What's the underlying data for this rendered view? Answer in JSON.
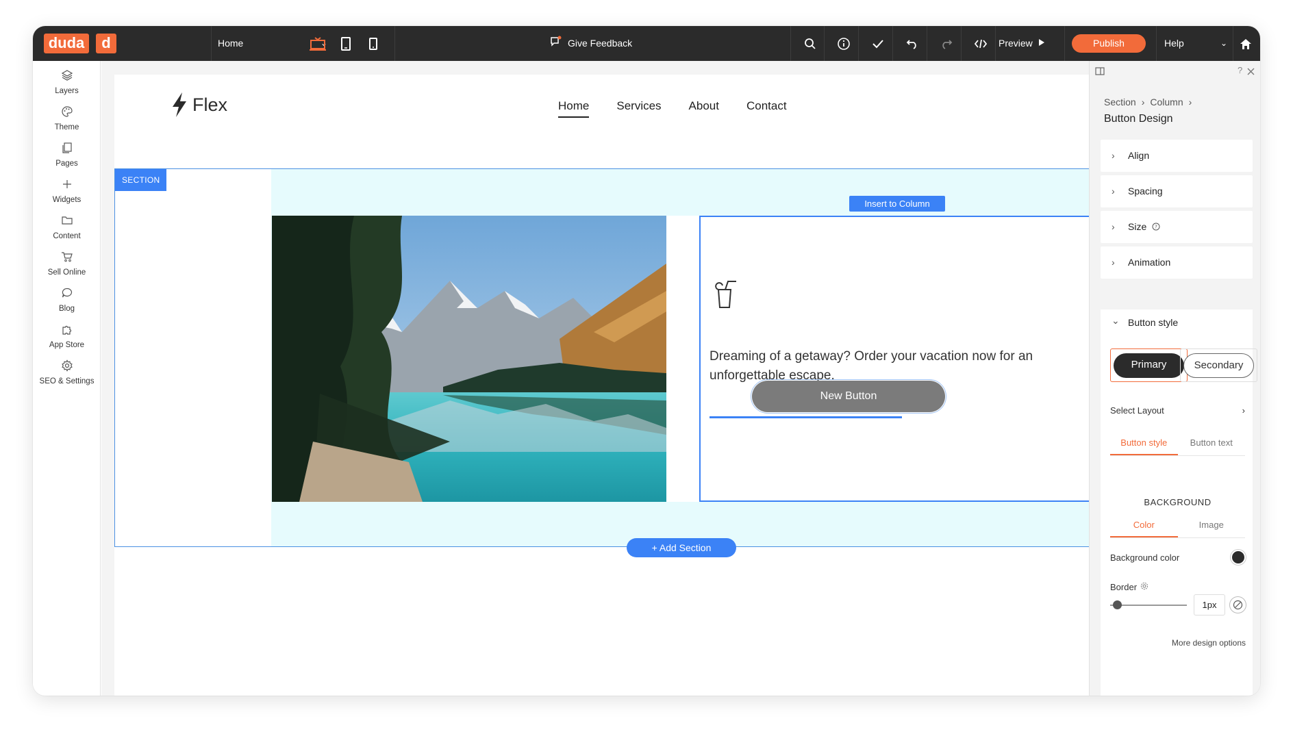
{
  "topbar": {
    "logo": "duda",
    "logo_short": "d",
    "page_selector": "Home",
    "feedback": "Give Feedback",
    "preview": "Preview",
    "publish": "Publish",
    "help": "Help"
  },
  "sidebar": {
    "items": [
      {
        "label": "Layers",
        "icon": "layers-icon"
      },
      {
        "label": "Theme",
        "icon": "palette-icon"
      },
      {
        "label": "Pages",
        "icon": "pages-icon"
      },
      {
        "label": "Widgets",
        "icon": "plus-icon"
      },
      {
        "label": "Content",
        "icon": "folder-icon"
      },
      {
        "label": "Sell Online",
        "icon": "cart-icon"
      },
      {
        "label": "Blog",
        "icon": "chat-icon"
      },
      {
        "label": "App Store",
        "icon": "puzzle-icon"
      },
      {
        "label": "SEO & Settings",
        "icon": "gear-icon"
      }
    ]
  },
  "site": {
    "logo_text": "Flex",
    "nav": [
      "Home",
      "Services",
      "About",
      "Contact"
    ],
    "section_tag": "SECTION",
    "insert_column": "Insert to Column",
    "body_text": "Dreaming of a getaway? Order your vacation now for an unforgettable escape.",
    "button_label": "New Button",
    "add_section": "+ Add Section"
  },
  "panel": {
    "breadcrumb": [
      "Section",
      "Column"
    ],
    "title": "Button Design",
    "accordions": [
      "Align",
      "Spacing",
      "Size",
      "Animation"
    ],
    "button_style": {
      "label": "Button style",
      "primary": "Primary",
      "secondary": "Secondary",
      "select_layout": "Select Layout",
      "tabs": [
        "Button style",
        "Button text"
      ],
      "background_label": "BACKGROUND",
      "bg_tabs": [
        "Color",
        "Image"
      ],
      "background_color_label": "Background color",
      "background_color": "#2b2b2b",
      "border_label": "Border",
      "border_value": "1px",
      "more_options": "More design options"
    }
  },
  "colors": {
    "accent": "#f26b3a",
    "selection": "#3b82f6"
  }
}
